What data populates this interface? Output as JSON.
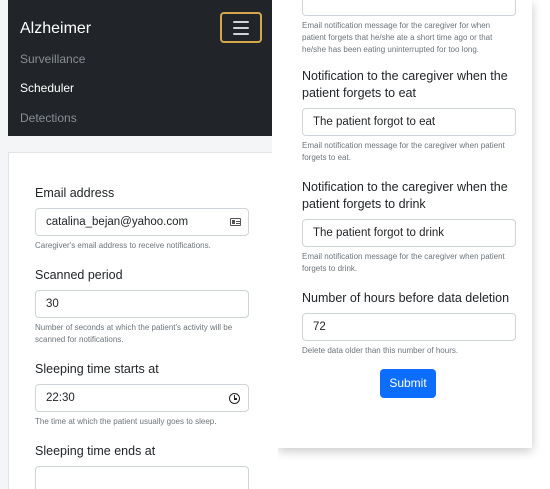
{
  "navbar": {
    "brand": "Alzheimer",
    "toggler_icon": "hamburger-menu-icon",
    "links": [
      "Surveillance",
      "Scheduler",
      "Detections"
    ],
    "active_link": "Scheduler"
  },
  "left_form": {
    "email": {
      "label": "Email address",
      "value": "catalina_bejan@yahoo.com",
      "help": "Caregiver's email address to receive notifications.",
      "icon": "contact-card-icon"
    },
    "scanned_period": {
      "label": "Scanned period",
      "value": "30",
      "help": "Number of seconds at which the patient's activity will be scanned for notifications."
    },
    "sleep_start": {
      "label": "Sleeping time starts at",
      "value": "22:30",
      "help": "The time at which the patient usually goes to sleep.",
      "icon": "clock-icon"
    },
    "sleep_end": {
      "label": "Sleeping time ends at"
    }
  },
  "right_form": {
    "top_help": "Email notification message for the caregiver for when patient forgets that he/she ate a short time ago or that he/she has been eating uninterrupted for too long.",
    "forgot_eat": {
      "label": "Notification to the caregiver when the patient forgets to eat",
      "value": "The patient forgot to eat",
      "help": "Email notification message for the caregiver when patient forgets to eat."
    },
    "forgot_drink": {
      "label": "Notification to the caregiver when the patient forgets to drink",
      "value": "The patient forgot to drink",
      "help": "Email notification message for the caregiver when patient forgets to drink."
    },
    "deletion_hours": {
      "label": "Number of hours before data deletion",
      "value": "72",
      "help": "Delete data older than this number of hours."
    },
    "submit_label": "Submit"
  },
  "colors": {
    "navbar_bg": "#212529",
    "toggler_border": "#d4a84a",
    "primary": "#0d6efd"
  }
}
